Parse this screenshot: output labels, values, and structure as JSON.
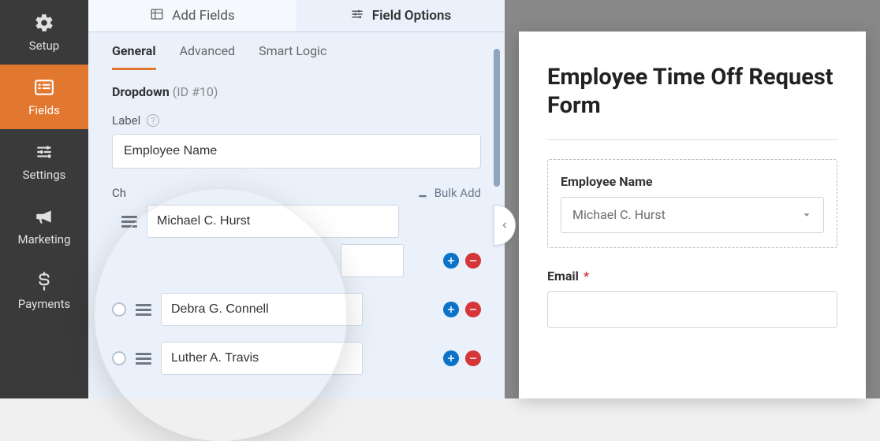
{
  "sidebar": {
    "items": [
      {
        "id": "setup",
        "label": "Setup"
      },
      {
        "id": "fields",
        "label": "Fields"
      },
      {
        "id": "settings",
        "label": "Settings"
      },
      {
        "id": "marketing",
        "label": "Marketing"
      },
      {
        "id": "payments",
        "label": "Payments"
      }
    ],
    "active": "fields"
  },
  "top_tabs": {
    "add_fields": "Add Fields",
    "field_options": "Field Options",
    "active": "field_options"
  },
  "sub_tabs": {
    "general": "General",
    "advanced": "Advanced",
    "smart_logic": "Smart Logic",
    "active": "general"
  },
  "field": {
    "type": "Dropdown",
    "id_label": "(ID #10)",
    "label_heading": "Label",
    "label_value": "Employee Name",
    "choices_heading": "Ch",
    "bulk_add": "Bulk Add",
    "choices": [
      {
        "value": "Michael C. Hurst"
      },
      {
        "value": "Debra G. Connell"
      },
      {
        "value": "Luther A. Travis"
      }
    ]
  },
  "preview": {
    "form_title": "Employee Time Off Request Form",
    "field_employee_name": {
      "label": "Employee Name",
      "selected": "Michael C. Hurst"
    },
    "field_email": {
      "label": "Email",
      "required": true
    }
  },
  "colors": {
    "accent": "#e27730",
    "blue": "#0a73c7",
    "red": "#d63638"
  }
}
